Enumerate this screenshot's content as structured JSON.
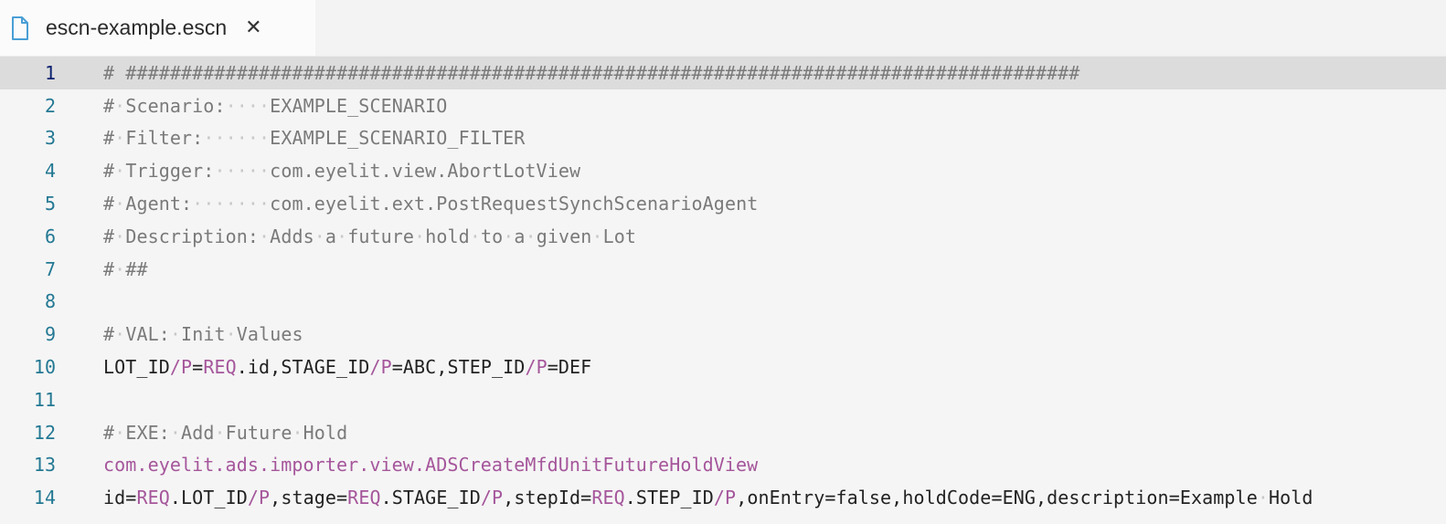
{
  "tab": {
    "title": "escn-example.escn",
    "file_icon": "file-icon",
    "close_icon": "close-icon"
  },
  "colors": {
    "line_number": "#237893",
    "active_line_number": "#0b216f",
    "comment": "#7a7a7a",
    "keyword": "#a5569b",
    "plain": "#222222",
    "active_line_bg": "#dcdcdc"
  },
  "lines": [
    {
      "num": "1",
      "active": true,
      "segments": [
        {
          "t": "c",
          "v": "# ######################################################################################"
        }
      ]
    },
    {
      "num": "2",
      "segments": [
        {
          "t": "c",
          "v": "#·Scenario:····EXAMPLE_SCENARIO"
        }
      ]
    },
    {
      "num": "3",
      "segments": [
        {
          "t": "c",
          "v": "#·Filter:······EXAMPLE_SCENARIO_FILTER"
        }
      ]
    },
    {
      "num": "4",
      "segments": [
        {
          "t": "c",
          "v": "#·Trigger:·····com.eyelit.view.AbortLotView"
        }
      ]
    },
    {
      "num": "5",
      "segments": [
        {
          "t": "c",
          "v": "#·Agent:·······com.eyelit.ext.PostRequestSynchScenarioAgent"
        }
      ]
    },
    {
      "num": "6",
      "segments": [
        {
          "t": "c",
          "v": "#·Description:·Adds·a·future·hold·to·a·given·Lot"
        }
      ]
    },
    {
      "num": "7",
      "segments": [
        {
          "t": "c",
          "v": "#·##"
        }
      ]
    },
    {
      "num": "8",
      "segments": []
    },
    {
      "num": "9",
      "segments": [
        {
          "t": "c",
          "v": "#·VAL:·Init·Values"
        }
      ]
    },
    {
      "num": "10",
      "segments": [
        {
          "t": "p",
          "v": "LOT_ID"
        },
        {
          "t": "k",
          "v": "/P"
        },
        {
          "t": "p",
          "v": "="
        },
        {
          "t": "k",
          "v": "REQ"
        },
        {
          "t": "p",
          "v": ".id,STAGE_ID"
        },
        {
          "t": "k",
          "v": "/P"
        },
        {
          "t": "p",
          "v": "=ABC,STEP_ID"
        },
        {
          "t": "k",
          "v": "/P"
        },
        {
          "t": "p",
          "v": "=DEF"
        }
      ]
    },
    {
      "num": "11",
      "segments": []
    },
    {
      "num": "12",
      "segments": [
        {
          "t": "c",
          "v": "#·EXE:·Add·Future·Hold"
        }
      ]
    },
    {
      "num": "13",
      "segments": [
        {
          "t": "k",
          "v": "com.eyelit.ads.importer.view.ADSCreateMfdUnitFutureHoldView"
        }
      ]
    },
    {
      "num": "14",
      "segments": [
        {
          "t": "p",
          "v": "id="
        },
        {
          "t": "k",
          "v": "REQ"
        },
        {
          "t": "p",
          "v": ".LOT_ID"
        },
        {
          "t": "k",
          "v": "/P"
        },
        {
          "t": "p",
          "v": ",stage="
        },
        {
          "t": "k",
          "v": "REQ"
        },
        {
          "t": "p",
          "v": ".STAGE_ID"
        },
        {
          "t": "k",
          "v": "/P"
        },
        {
          "t": "p",
          "v": ",stepId="
        },
        {
          "t": "k",
          "v": "REQ"
        },
        {
          "t": "p",
          "v": ".STEP_ID"
        },
        {
          "t": "k",
          "v": "/P"
        },
        {
          "t": "p",
          "v": ",onEntry=false,holdCode=ENG,description=Example·Hold"
        }
      ]
    }
  ]
}
